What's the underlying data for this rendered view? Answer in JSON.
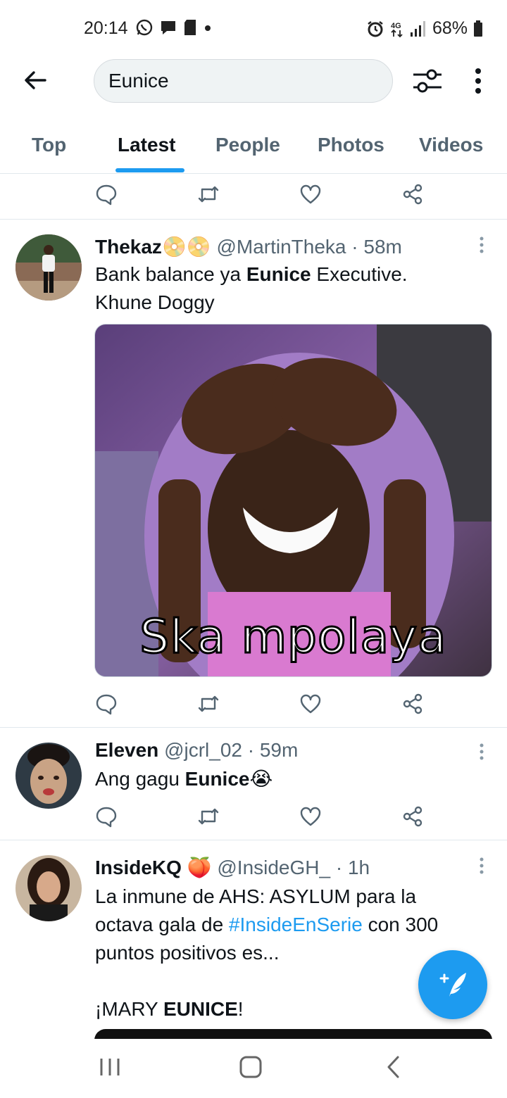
{
  "status_bar": {
    "time": "20:14",
    "battery": "68%",
    "network": "4G",
    "left_icons": [
      "whatsapp-icon",
      "message-icon",
      "sd-card-icon",
      "dot-icon"
    ],
    "right_icons": [
      "alarm-icon",
      "network-4g-icon",
      "signal-icon",
      "battery-icon"
    ]
  },
  "header": {
    "search_value": "Eunice",
    "icons": [
      "back-arrow-icon",
      "filter-sliders-icon",
      "more-vertical-icon"
    ]
  },
  "tabs": [
    {
      "label": "Top",
      "active": false
    },
    {
      "label": "Latest",
      "active": true
    },
    {
      "label": "People",
      "active": false
    },
    {
      "label": "Photos",
      "active": false
    },
    {
      "label": "Videos",
      "active": false
    }
  ],
  "tweets": [
    {
      "name": "Thekaz",
      "name_emoji": "📀📀",
      "handle": "@MartinTheka",
      "sep": " · ",
      "time": "58m",
      "text_before": "Bank balance ya ",
      "text_bold": "Eunice",
      "text_after": " Executive.",
      "text_line2": "Khune Doggy",
      "media_caption": "Ska mpolaya"
    },
    {
      "name": "Eleven",
      "handle": "@jcrl_02",
      "sep": " · ",
      "time": "59m",
      "text_before": "Ang gagu ",
      "text_bold": "Eunice",
      "text_emoji": "😭"
    },
    {
      "name": "InsideKQ",
      "name_emoji": "🍑",
      "handle": "@InsideGH_",
      "sep": " · ",
      "time": "1h",
      "line1": "La inmune de AHS: ASYLUM para la",
      "line2_before": "octava gala de ",
      "hashtag": "#InsideEnSerie",
      "line2_after": " con 300",
      "line3": "puntos positivos es...",
      "line4_before": "¡MARY ",
      "line4_bold": "EUNICE",
      "line4_after": "!"
    }
  ],
  "action_icons": [
    "reply-icon",
    "retweet-icon",
    "like-icon",
    "share-icon"
  ],
  "colors": {
    "accent": "#1d9bf0",
    "text_primary": "#0f1419",
    "text_secondary": "#536471",
    "divider": "#e1e8ed"
  },
  "fab": {
    "icon": "compose-tweet-icon"
  },
  "nav_bar": {
    "icons": [
      "recent-apps-icon",
      "home-icon",
      "back-icon"
    ]
  }
}
